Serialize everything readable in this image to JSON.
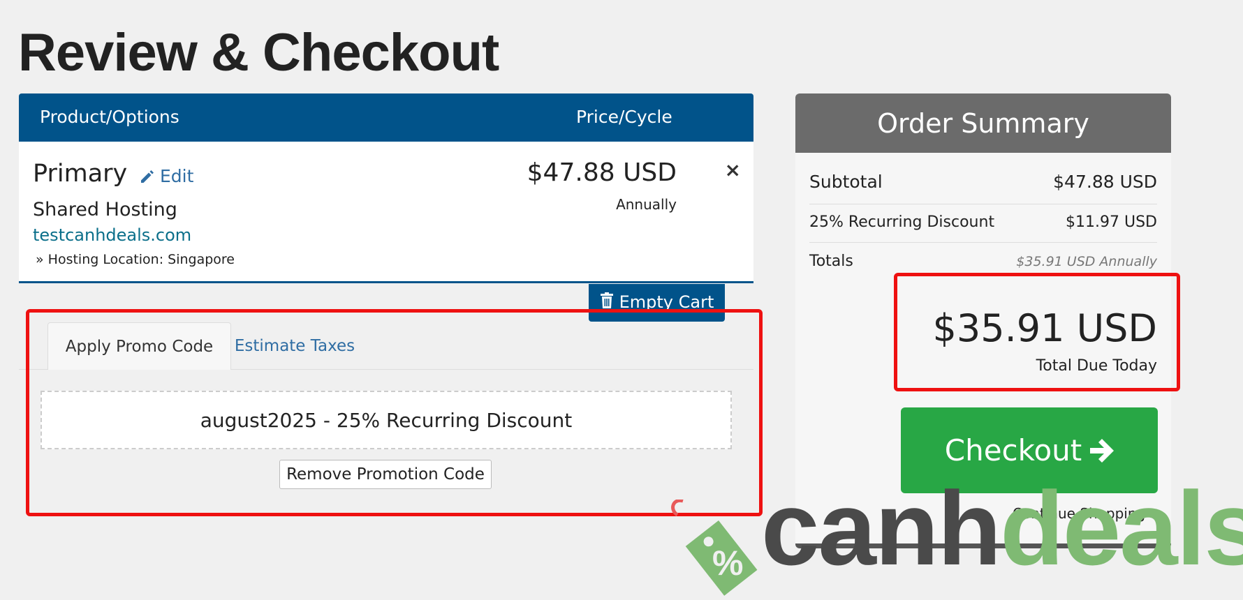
{
  "page": {
    "title": "Review & Checkout"
  },
  "cart": {
    "headers": {
      "product": "Product/Options",
      "price": "Price/Cycle"
    },
    "item": {
      "name": "Primary",
      "edit_label": "Edit",
      "group": "Shared Hosting",
      "domain": "testcanhdeals.com",
      "option": "» Hosting Location: Singapore",
      "price": "$47.88 USD",
      "cycle": "Annually",
      "remove_icon": "×"
    },
    "empty_cart_label": "Empty Cart"
  },
  "promo": {
    "tabs": [
      {
        "label": "Apply Promo Code",
        "active": true
      },
      {
        "label": "Estimate Taxes",
        "active": false
      }
    ],
    "applied_code": "august2025 - 25% Recurring Discount",
    "remove_label": "Remove Promotion Code"
  },
  "summary": {
    "title": "Order Summary",
    "subtotal_label": "Subtotal",
    "subtotal_value": "$47.88 USD",
    "discount_label": "25% Recurring Discount",
    "discount_value": "$11.97 USD",
    "totals_label": "Totals",
    "totals_value": "$35.91 USD Annually",
    "total_due": "$35.91 USD",
    "total_due_label": "Total Due Today",
    "checkout_label": "Checkout",
    "continue_label": "Continue Shopping"
  },
  "watermark": {
    "part1": "canh",
    "part2": "deals",
    "tag_symbol": "%"
  },
  "colors": {
    "header_blue": "#01538a",
    "checkout_green": "#28a745",
    "highlight_red": "#ee1111",
    "summary_header": "#6b6b6b"
  }
}
